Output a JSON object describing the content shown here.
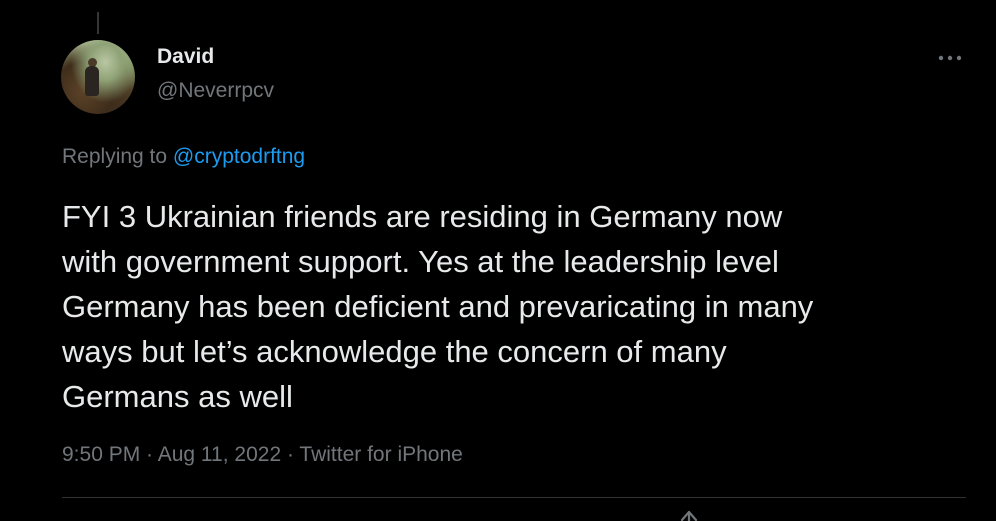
{
  "author": {
    "display_name": "David",
    "handle": "@Neverrpcv"
  },
  "more_icon": "more-dots-icon",
  "reply_context": {
    "prefix": "Replying to ",
    "mention": "@cryptodrftng"
  },
  "tweet": {
    "text": "FYI 3 Ukrainian friends are residing in Germany now\nwith government support. Yes at the leadership level\nGermany has been deficient and prevaricating in many\nways but let’s acknowledge the concern of many\nGermans as well"
  },
  "meta": {
    "time": "9:50 PM",
    "date": "Aug 11, 2022",
    "source": "Twitter for iPhone",
    "separator": " · "
  },
  "colors": {
    "background": "#000000",
    "text": "#e7e9ea",
    "secondary": "#71767b",
    "link": "#1d9bf0"
  }
}
